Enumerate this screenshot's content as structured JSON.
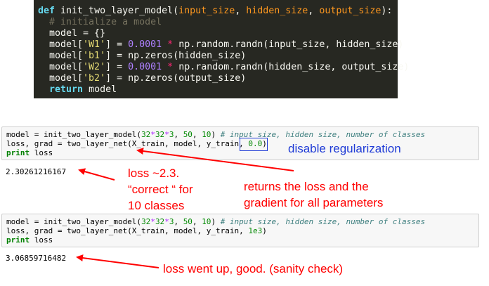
{
  "code_block": {
    "lines": [
      [
        {
          "t": "def ",
          "c": "kw"
        },
        {
          "t": "init_two_layer_model",
          "c": "fn"
        },
        {
          "t": "(",
          "c": "fn"
        },
        {
          "t": "input_size",
          "c": "arg"
        },
        {
          "t": ", ",
          "c": "fn"
        },
        {
          "t": "hidden_size",
          "c": "arg"
        },
        {
          "t": ", ",
          "c": "fn"
        },
        {
          "t": "output_size",
          "c": "arg"
        },
        {
          "t": "):",
          "c": "fn"
        }
      ],
      [
        {
          "t": "  # initialize a model",
          "c": "cm"
        }
      ],
      [
        {
          "t": "  model = {}",
          "c": "fn"
        }
      ],
      [
        {
          "t": "  model[",
          "c": "fn"
        },
        {
          "t": "'W1'",
          "c": "str"
        },
        {
          "t": "] = ",
          "c": "fn"
        },
        {
          "t": "0.0001",
          "c": "num"
        },
        {
          "t": " * ",
          "c": "op"
        },
        {
          "t": "np.random.randn(input_size, hidden_size)",
          "c": "fn"
        }
      ],
      [
        {
          "t": "  model[",
          "c": "fn"
        },
        {
          "t": "'b1'",
          "c": "str"
        },
        {
          "t": "] = np.zeros(hidden_size)",
          "c": "fn"
        }
      ],
      [
        {
          "t": "  model[",
          "c": "fn"
        },
        {
          "t": "'W2'",
          "c": "str"
        },
        {
          "t": "] = ",
          "c": "fn"
        },
        {
          "t": "0.0001",
          "c": "num"
        },
        {
          "t": " * ",
          "c": "op"
        },
        {
          "t": "np.random.randn(hidden_size, output_size)",
          "c": "fn"
        }
      ],
      [
        {
          "t": "  model[",
          "c": "fn"
        },
        {
          "t": "'b2'",
          "c": "str"
        },
        {
          "t": "] = np.zeros(output_size)",
          "c": "fn"
        }
      ],
      [
        {
          "t": "  ",
          "c": "fn"
        },
        {
          "t": "return",
          "c": "kw"
        },
        {
          "t": " model",
          "c": "fn"
        }
      ]
    ]
  },
  "cell1": {
    "lines": [
      [
        {
          "t": "model = init_two_layer_model(",
          "c": ""
        },
        {
          "t": "32",
          "c": "num"
        },
        {
          "t": "*",
          "c": "op"
        },
        {
          "t": "32",
          "c": "num"
        },
        {
          "t": "*",
          "c": "op"
        },
        {
          "t": "3",
          "c": "num"
        },
        {
          "t": ", ",
          "c": ""
        },
        {
          "t": "50",
          "c": "num"
        },
        {
          "t": ", ",
          "c": ""
        },
        {
          "t": "10",
          "c": "num"
        },
        {
          "t": ") ",
          "c": ""
        },
        {
          "t": "# input size, hidden size, number of classes",
          "c": "cm"
        }
      ],
      [
        {
          "t": "loss, grad = two_layer_net(X_train, model, y_train, ",
          "c": ""
        },
        {
          "t": "0.0",
          "c": "num"
        },
        {
          "t": ")",
          "c": ""
        }
      ],
      [
        {
          "t": "print",
          "c": "kw"
        },
        {
          "t": " loss",
          "c": ""
        }
      ]
    ]
  },
  "output1": "2.30261216167",
  "cell2": {
    "lines": [
      [
        {
          "t": "model = init_two_layer_model(",
          "c": ""
        },
        {
          "t": "32",
          "c": "num"
        },
        {
          "t": "*",
          "c": "op"
        },
        {
          "t": "32",
          "c": "num"
        },
        {
          "t": "*",
          "c": "op"
        },
        {
          "t": "3",
          "c": "num"
        },
        {
          "t": ", ",
          "c": ""
        },
        {
          "t": "50",
          "c": "num"
        },
        {
          "t": ", ",
          "c": ""
        },
        {
          "t": "10",
          "c": "num"
        },
        {
          "t": ") ",
          "c": ""
        },
        {
          "t": "# input size, hidden size, number of classes",
          "c": "cm"
        }
      ],
      [
        {
          "t": "loss, grad = two_layer_net(X_train, model, y_train, ",
          "c": ""
        },
        {
          "t": "1e3",
          "c": "num"
        },
        {
          "t": ")",
          "c": ""
        }
      ],
      [
        {
          "t": "print",
          "c": "kw"
        },
        {
          "t": " loss",
          "c": ""
        }
      ]
    ]
  },
  "output2": "3.06859716482",
  "annotations": {
    "disable_reg": "disable regularization",
    "loss_line1": "loss ~2.3.",
    "loss_line2": "“correct “ for",
    "loss_line3": "10 classes",
    "returns_line1": "returns the loss and the",
    "returns_line2": "gradient for all parameters",
    "went_up": "loss went up, good. (sanity check)"
  },
  "colors": {
    "annotation_red": "#ff0000",
    "annotation_blue": "#1f3bd6",
    "code_bg": "#272822"
  }
}
